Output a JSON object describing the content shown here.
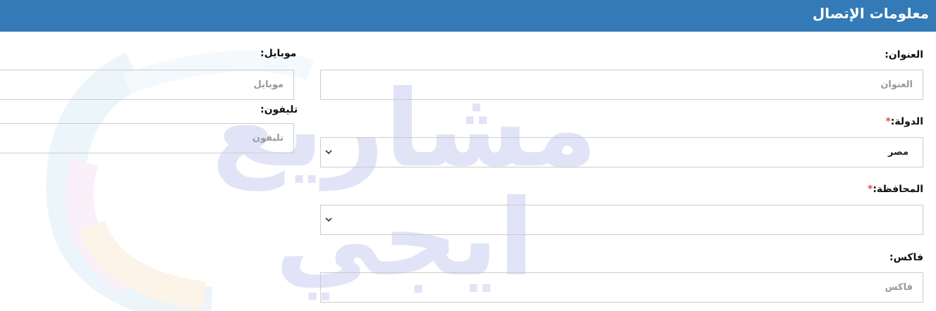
{
  "header": {
    "title": "معلومات الإتصال"
  },
  "form": {
    "address": {
      "label": "العنوان:",
      "placeholder": "العنوان",
      "value": ""
    },
    "country": {
      "label": "الدولة:",
      "required_mark": "*",
      "value": "مصر"
    },
    "governorate": {
      "label": "المحافظة:",
      "required_mark": "*",
      "value": ""
    },
    "fax": {
      "label": "فاكس:",
      "placeholder": "فاكس",
      "value": ""
    },
    "mobile": {
      "label": "موبايل:",
      "placeholder": "موبايل",
      "value": ""
    },
    "phone": {
      "label": "تليفون:",
      "placeholder": "تليفون",
      "value": ""
    }
  },
  "icons": {
    "select_arrow": "chevron-down-icon"
  },
  "colors": {
    "header_bg": "#337ab7",
    "required": "#d9534f",
    "border": "#cccccc"
  }
}
